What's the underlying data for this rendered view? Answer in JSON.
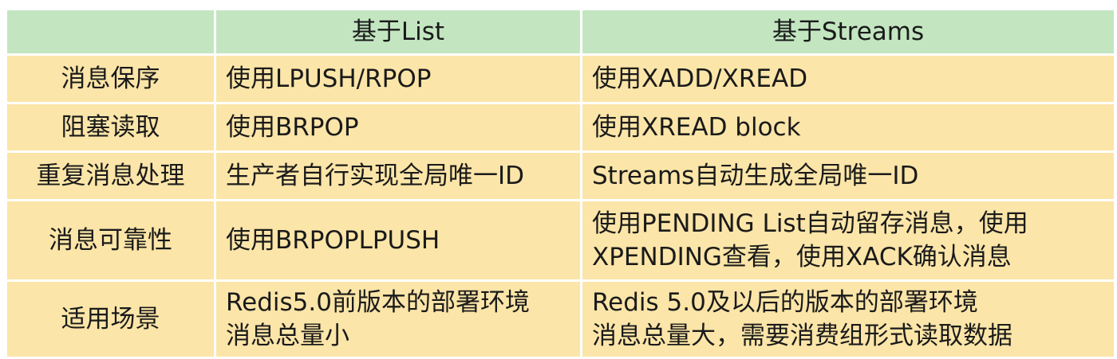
{
  "header": {
    "corner": "",
    "col_list": "基于List",
    "col_streams": "基于Streams"
  },
  "rows": [
    {
      "label": "消息保序",
      "list": [
        "使用LPUSH/RPOP"
      ],
      "streams": [
        "使用XADD/XREAD"
      ]
    },
    {
      "label": "阻塞读取",
      "list": [
        "使用BRPOP"
      ],
      "streams": [
        "使用XREAD block"
      ]
    },
    {
      "label": "重复消息处理",
      "list": [
        "生产者自行实现全局唯一ID"
      ],
      "streams": [
        "Streams自动生成全局唯一ID"
      ]
    },
    {
      "label": "消息可靠性",
      "list": [
        "使用BRPOPLPUSH"
      ],
      "streams": [
        "使用PENDING List自动留存消息，使用",
        "XPENDING查看，使用XACK确认消息"
      ]
    },
    {
      "label": "适用场景",
      "list": [
        "Redis5.0前版本的部署环境",
        "消息总量小"
      ],
      "streams": [
        "Redis 5.0及以后的版本的部署环境",
        "消息总量大，需要消费组形式读取数据"
      ]
    }
  ],
  "colors": {
    "header_bg": "#c3e6c1",
    "body_bg": "#fbe5a8",
    "grid": "#ffffff"
  }
}
